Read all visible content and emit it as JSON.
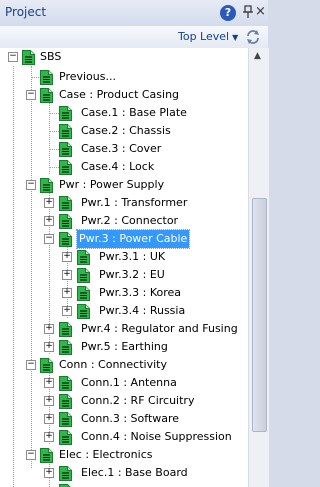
{
  "panel": {
    "title": "Project",
    "help_icon": "?",
    "close_icon": "×"
  },
  "toolbar": {
    "level_label": "Top Level",
    "level_arrow": "▼",
    "refresh_icon": "refresh-icon"
  },
  "colors": {
    "accent": "#3399ff",
    "doc_icon": "#2db84a",
    "title_text": "#15428b"
  },
  "tree": {
    "nodes": [
      {
        "label": "SBS",
        "toggle": "−"
      },
      {
        "label": "Previous...",
        "toggle": ""
      },
      {
        "label": "Case : Product Casing",
        "toggle": "−"
      },
      {
        "label": "Case.1 : Base Plate",
        "toggle": ""
      },
      {
        "label": "Case.2 : Chassis",
        "toggle": ""
      },
      {
        "label": "Case.3 : Cover",
        "toggle": ""
      },
      {
        "label": "Case.4 : Lock",
        "toggle": ""
      },
      {
        "label": "Pwr : Power Supply",
        "toggle": "−"
      },
      {
        "label": "Pwr.1 : Transformer",
        "toggle": "+"
      },
      {
        "label": "Pwr.2 : Connector",
        "toggle": "+"
      },
      {
        "label": "Pwr.3 : Power Cable",
        "toggle": "−",
        "selected": true
      },
      {
        "label": "Pwr.3.1 : UK",
        "toggle": "+"
      },
      {
        "label": "Pwr.3.2 : EU",
        "toggle": "+"
      },
      {
        "label": "Pwr.3.3 : Korea",
        "toggle": "+"
      },
      {
        "label": "Pwr.3.4 : Russia",
        "toggle": "+"
      },
      {
        "label": "Pwr.4 : Regulator and Fusing",
        "toggle": "+"
      },
      {
        "label": "Pwr.5 : Earthing",
        "toggle": "+"
      },
      {
        "label": "Conn : Connectivity",
        "toggle": "−"
      },
      {
        "label": "Conn.1 : Antenna",
        "toggle": "+"
      },
      {
        "label": "Conn.2 : RF Circuitry",
        "toggle": "+"
      },
      {
        "label": "Conn.3 : Software",
        "toggle": "+"
      },
      {
        "label": "Conn.4 : Noise Suppression",
        "toggle": "+"
      },
      {
        "label": "Elec : Electronics",
        "toggle": "−"
      },
      {
        "label": "Elec.1 : Base Board",
        "toggle": "+"
      },
      {
        "label": "",
        "toggle": ""
      }
    ]
  }
}
